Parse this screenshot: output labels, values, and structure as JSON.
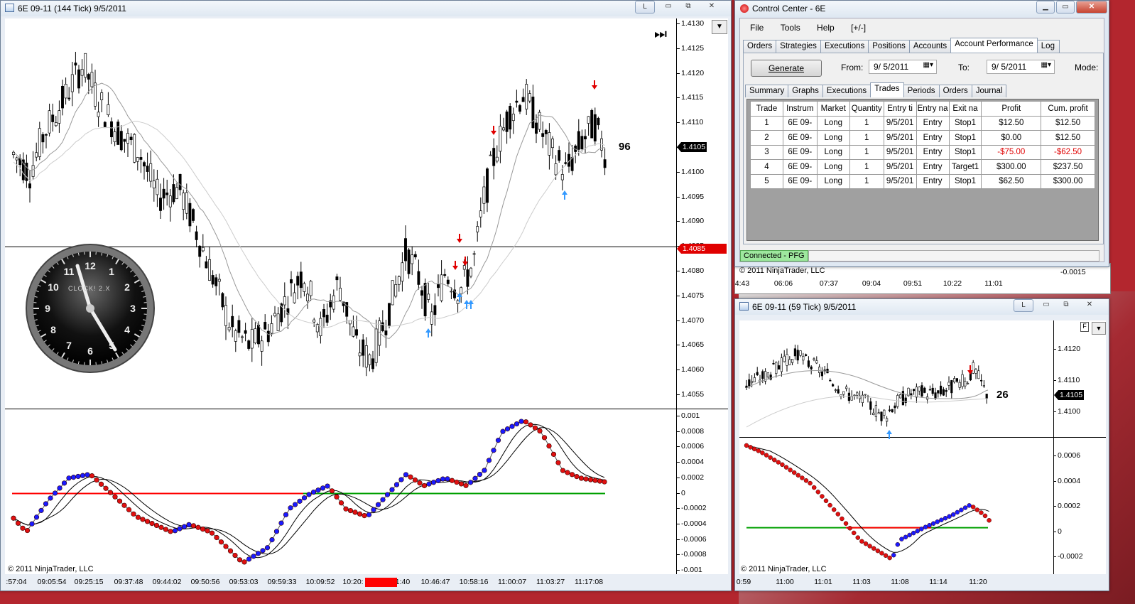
{
  "main_chart": {
    "title": "6E 09-11 (144 Tick)  9/5/2011",
    "buttons": {
      "link": "L",
      "restore": "⧉",
      "minimize": "▭",
      "close": "✕"
    },
    "price_axis": [
      "1.4130",
      "1.4125",
      "1.4120",
      "1.4115",
      "1.4110",
      "1.4105",
      "1.4100",
      "1.4095",
      "1.4090",
      "1.4085",
      "1.4080",
      "1.4075",
      "1.4070",
      "1.4065",
      "1.4060",
      "1.4055"
    ],
    "last_price": "1.4105",
    "line_price": "1.4085",
    "bar_counter": "96",
    "indicator_axis": [
      "0.001",
      "0.0008",
      "0.0006",
      "0.0004",
      "0.0002",
      "0",
      "-0.0002",
      "-0.0004",
      "-0.0006",
      "-0.0008",
      "-0.001"
    ],
    "time_axis": [
      ":57:04",
      "09:05:54",
      "09:25:15",
      "09:37:48",
      "09:44:02",
      "09:50:56",
      "09:53:03",
      "09:59:33",
      "10:09:52",
      "10:20:",
      "1:40",
      "10:46:47",
      "10:58:16",
      "11:00:07",
      "11:03:27",
      "11:17:08"
    ],
    "copyright": "© 2011 NinjaTrader, LLC",
    "clock_label": "CLOCK! 2.X",
    "clock_numbers": [
      "12",
      "1",
      "2",
      "3",
      "4",
      "5",
      "6",
      "7",
      "8",
      "9",
      "10",
      "11"
    ],
    "colors": {
      "up": "#0000ff",
      "down": "#e00000",
      "zero_green": "#00a000",
      "signal_red": "#ff0000",
      "arrow_up": "#3399ff"
    }
  },
  "control_center": {
    "title": "Control Center - 6E",
    "menu": [
      "File",
      "Tools",
      "Help",
      "[+/-]"
    ],
    "tabs": [
      "Orders",
      "Strategies",
      "Executions",
      "Positions",
      "Accounts",
      "Account Performance",
      "Log"
    ],
    "active_tab": "Account Performance",
    "generate_label": "Generate",
    "from_label": "From:",
    "from_value": "9/ 5/2011",
    "to_label": "To:",
    "to_value": "9/ 5/2011",
    "mode_label": "Mode:",
    "subtabs": [
      "Summary",
      "Graphs",
      "Executions",
      "Trades",
      "Periods",
      "Orders",
      "Journal"
    ],
    "active_subtab": "Trades",
    "columns": [
      "Trade",
      "Instrum",
      "Market",
      "Quantity",
      "Entry ti",
      "Entry na",
      "Exit na",
      "Profit",
      "Cum. profit"
    ],
    "rows": [
      {
        "trade": "1",
        "instrument": "6E 09-",
        "market": "Long",
        "qty": "1",
        "entry_time": "9/5/201",
        "entry_name": "Entry",
        "exit_name": "Stop1",
        "profit": "$12.50",
        "cum": "$12.50",
        "neg": false
      },
      {
        "trade": "2",
        "instrument": "6E 09-",
        "market": "Long",
        "qty": "1",
        "entry_time": "9/5/201",
        "entry_name": "Entry",
        "exit_name": "Stop1",
        "profit": "$0.00",
        "cum": "$12.50",
        "neg": false
      },
      {
        "trade": "3",
        "instrument": "6E 09-",
        "market": "Long",
        "qty": "1",
        "entry_time": "9/5/201",
        "entry_name": "Entry",
        "exit_name": "Stop1",
        "profit": "-$75.00",
        "cum": "-$62.50",
        "neg": true
      },
      {
        "trade": "4",
        "instrument": "6E 09-",
        "market": "Long",
        "qty": "1",
        "entry_time": "9/5/201",
        "entry_name": "Entry",
        "exit_name": "Target1",
        "profit": "$300.00",
        "cum": "$237.50",
        "neg": false
      },
      {
        "trade": "5",
        "instrument": "6E 09-",
        "market": "Long",
        "qty": "1",
        "entry_time": "9/5/201",
        "entry_name": "Entry",
        "exit_name": "Stop1",
        "profit": "$62.50",
        "cum": "$300.00",
        "neg": false
      }
    ],
    "status": "Connected - PFG"
  },
  "behind_window": {
    "copyright": "© 2011 NinjaTrader, LLC",
    "time_axis": [
      "4:43",
      "06:06",
      "07:37",
      "09:04",
      "09:51",
      "10:22",
      "11:01"
    ],
    "axis_value": "-0.0015"
  },
  "small_chart": {
    "title": "6E 09-11 (59 Tick)  9/5/2011",
    "price_axis": [
      "1.4120",
      "1.4110",
      "1.4100"
    ],
    "last_price": "1.4105",
    "bar_counter": "26",
    "f_label": "F",
    "indicator_axis": [
      "0.0006",
      "0.0004",
      "0.0002",
      "0",
      "-0.0002"
    ],
    "time_axis": [
      "0:59",
      "11:00",
      "11:01",
      "11:03",
      "11:08",
      "11:14",
      "11:20"
    ],
    "copyright": "© 2011 NinjaTrader, LLC"
  }
}
